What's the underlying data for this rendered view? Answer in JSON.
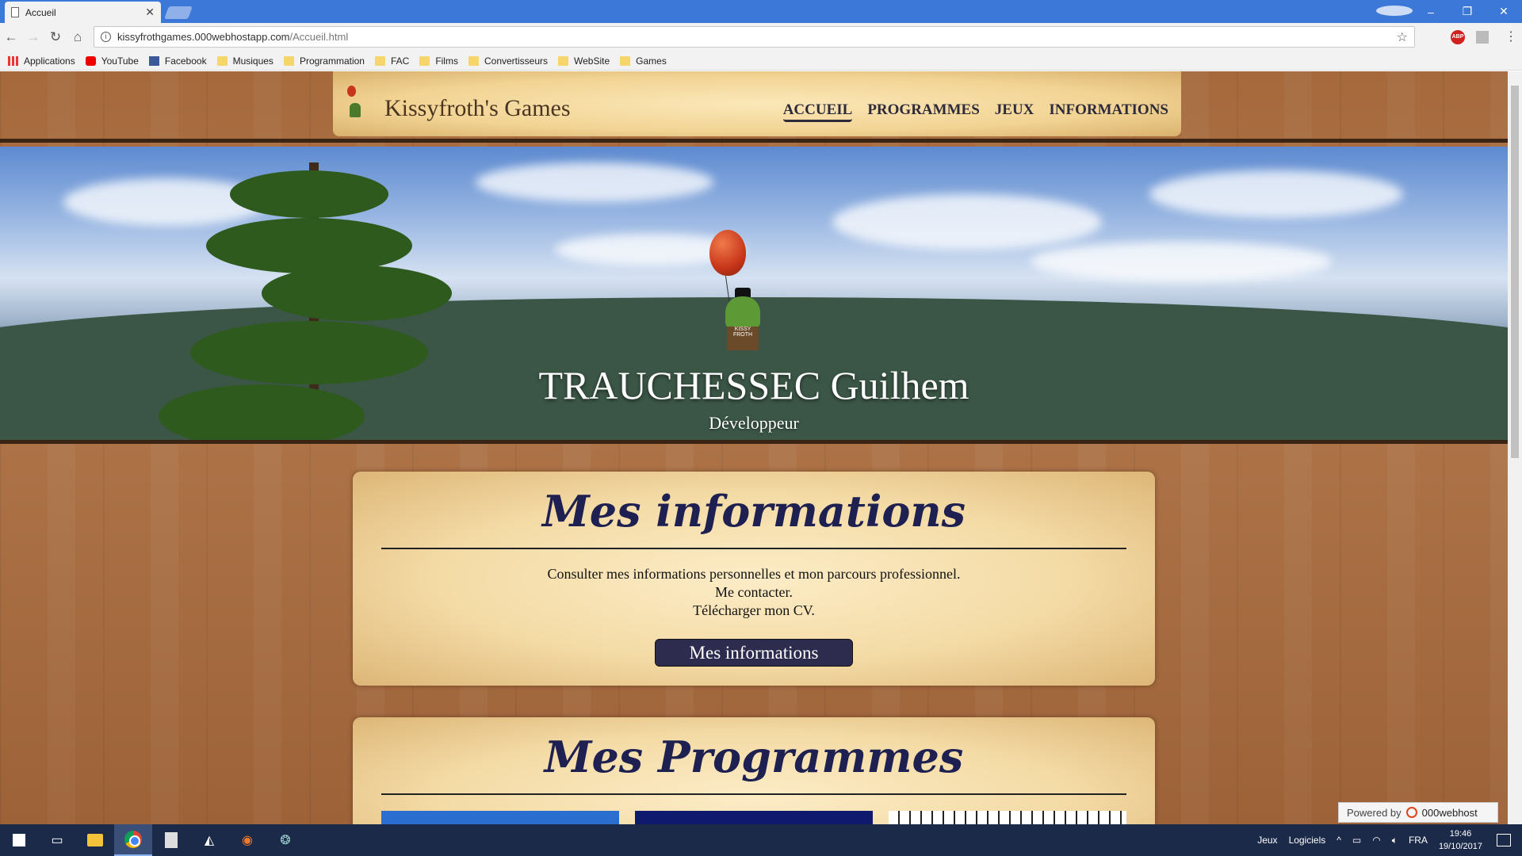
{
  "browser": {
    "tab_title": "Accueil",
    "tab_close": "✕",
    "url_host": "kissyfrothgames.000webhostapp.com",
    "url_path": "/Accueil.html",
    "controls": {
      "minimize": "–",
      "restore": "❐",
      "close": "✕"
    }
  },
  "bookmarks": [
    {
      "label": "Applications",
      "icon": "apps-icon"
    },
    {
      "label": "YouTube",
      "icon": "youtube-icon"
    },
    {
      "label": "Facebook",
      "icon": "facebook-icon"
    },
    {
      "label": "Musiques",
      "icon": "folder-icon"
    },
    {
      "label": "Programmation",
      "icon": "folder-icon"
    },
    {
      "label": "FAC",
      "icon": "folder-icon"
    },
    {
      "label": "Films",
      "icon": "folder-icon"
    },
    {
      "label": "Convertisseurs",
      "icon": "folder-icon"
    },
    {
      "label": "WebSite",
      "icon": "folder-icon"
    },
    {
      "label": "Games",
      "icon": "folder-icon"
    }
  ],
  "site": {
    "title": "Kissyfroth's Games",
    "nav": [
      "ACCUEIL",
      "PROGRAMMES",
      "JEUX",
      "INFORMATIONS"
    ],
    "active_nav": "ACCUEIL"
  },
  "banner": {
    "name": "TRAUCHESSEC Guilhem",
    "role": "Développeur",
    "pot_text": "KISSY FROTH"
  },
  "info_card": {
    "heading": "Mes informations",
    "lines": [
      "Consulter mes informations personnelles et mon parcours professionnel.",
      "Me contacter.",
      "Télécharger mon CV."
    ],
    "button": "Mes informations"
  },
  "programs_card": {
    "heading": "Mes Programmes"
  },
  "powered": {
    "prefix": "Powered by",
    "brand": "000webhost"
  },
  "taskbar": {
    "tray_jeux": "Jeux",
    "tray_logiciels": "Logiciels",
    "lang": "FRA",
    "time": "19:46",
    "date": "19/10/2017"
  },
  "colors": {
    "chrome_tabstrip": "#3c78d8",
    "nav_text": "#2d2a3a",
    "heading": "#1d2050",
    "button_bg": "#2d2c4f",
    "taskbar": "#1b2a48"
  }
}
